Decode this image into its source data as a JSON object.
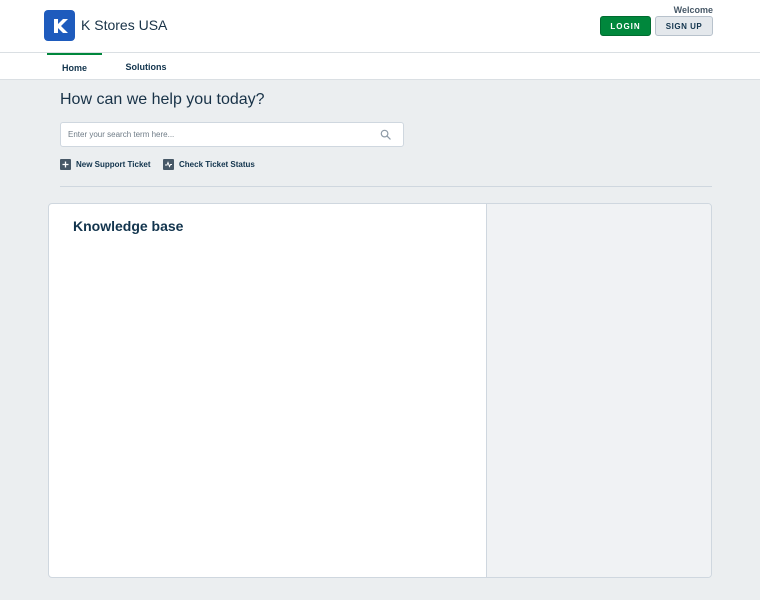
{
  "header": {
    "brand": "K Stores USA",
    "logo_letter": "K",
    "welcome": "Welcome",
    "login_label": "LOGIN",
    "signup_label": "SIGN UP"
  },
  "nav": {
    "tabs": [
      {
        "label": "Home",
        "active": true
      },
      {
        "label": "Solutions",
        "active": false
      }
    ]
  },
  "hero": {
    "title": "How can we help you today?",
    "search_placeholder": "Enter your search term here...",
    "actions": [
      {
        "label": "New Support Ticket",
        "icon": "plus-icon"
      },
      {
        "label": "Check Ticket Status",
        "icon": "activity-icon"
      }
    ]
  },
  "knowledge_base": {
    "title": "Knowledge base"
  },
  "colors": {
    "brand_blue": "#1e5bbd",
    "accent_green": "#00873c",
    "page_bg": "#ebeef0"
  }
}
